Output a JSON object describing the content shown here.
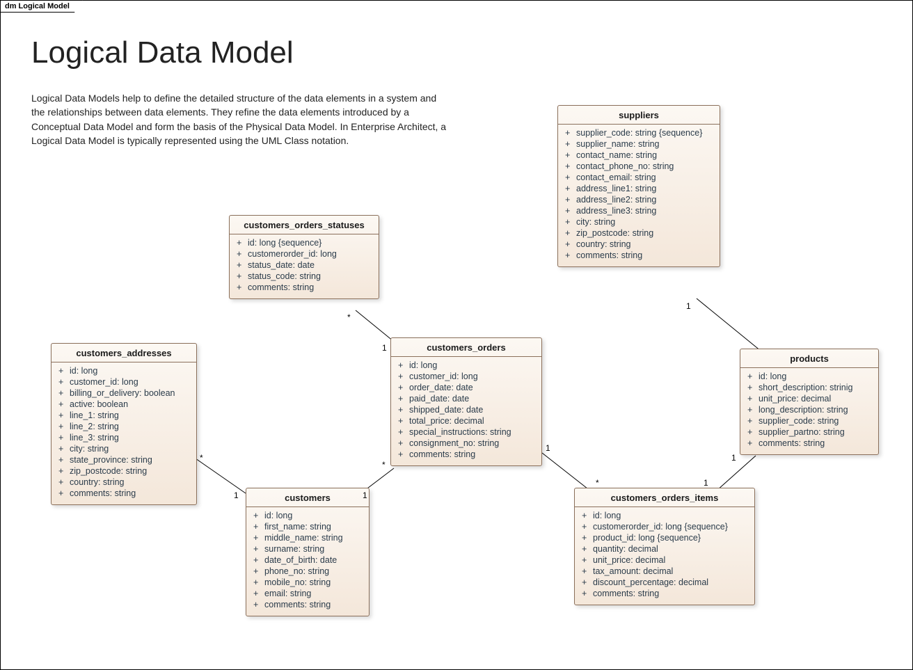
{
  "tab_label": "dm Logical Model",
  "title": "Logical Data Model",
  "lead": "Logical Data Models help to define the detailed structure of the data elements in a system and the relationships between data elements. They refine the data elements introduced by a Conceptual Data Model and form the basis of the Physical Data Model. In Enterprise Architect, a Logical Data Model is typically represented using the UML Class notation.",
  "entities": {
    "customers_orders_statuses": {
      "name": "customers_orders_statuses",
      "attrs": [
        "id: long {sequence}",
        "customerorder_id: long",
        "status_date: date",
        "status_code: string",
        "comments: string"
      ]
    },
    "customers_addresses": {
      "name": "customers_addresses",
      "attrs": [
        "id: long",
        "customer_id: long",
        "billing_or_delivery: boolean",
        "active: boolean",
        "line_1: string",
        "line_2: string",
        "line_3: string",
        "city: string",
        "state_province: string",
        "zip_postcode: string",
        "country: string",
        "comments: string"
      ]
    },
    "customers_orders": {
      "name": "customers_orders",
      "attrs": [
        "id: long",
        "customer_id: long",
        "order_date: date",
        "paid_date: date",
        "shipped_date: date",
        "total_price: decimal",
        "special_instructions: string",
        "consignment_no: string",
        "comments: string"
      ]
    },
    "suppliers": {
      "name": "suppliers",
      "attrs": [
        "supplier_code: string {sequence}",
        "supplier_name: string",
        "contact_name: string",
        "contact_phone_no: string",
        "contact_email: string",
        "address_line1: string",
        "address_line2: string",
        "address_line3: string",
        "city: string",
        "zip_postcode: string",
        "country: string",
        "comments: string"
      ]
    },
    "products": {
      "name": "products",
      "attrs": [
        "id: long",
        "short_description: strinig",
        "unit_price: decimal",
        "long_description: string",
        "supplier_code: string",
        "supplier_partno: string",
        "comments: string"
      ]
    },
    "customers": {
      "name": "customers",
      "attrs": [
        "id: long",
        "first_name: string",
        "middle_name: string",
        "surname: string",
        "date_of_birth: date",
        "phone_no: string",
        "mobile_no: string",
        "email: string",
        "comments: string"
      ]
    },
    "customers_orders_items": {
      "name": "customers_orders_items",
      "attrs": [
        "id: long",
        "customerorder_id: long {sequence}",
        "product_id: long {sequence}",
        "quantity: decimal",
        "unit_price: decimal",
        "tax_amount: decimal",
        "discount_percentage: decimal",
        "comments: string"
      ]
    }
  },
  "mults": {
    "m1": "*",
    "m2": "1",
    "m3": "*",
    "m4": "1",
    "m5": "*",
    "m6": "1",
    "m7": "1",
    "m8": "*",
    "m9": "1",
    "m10": "1",
    "m11": "1"
  }
}
